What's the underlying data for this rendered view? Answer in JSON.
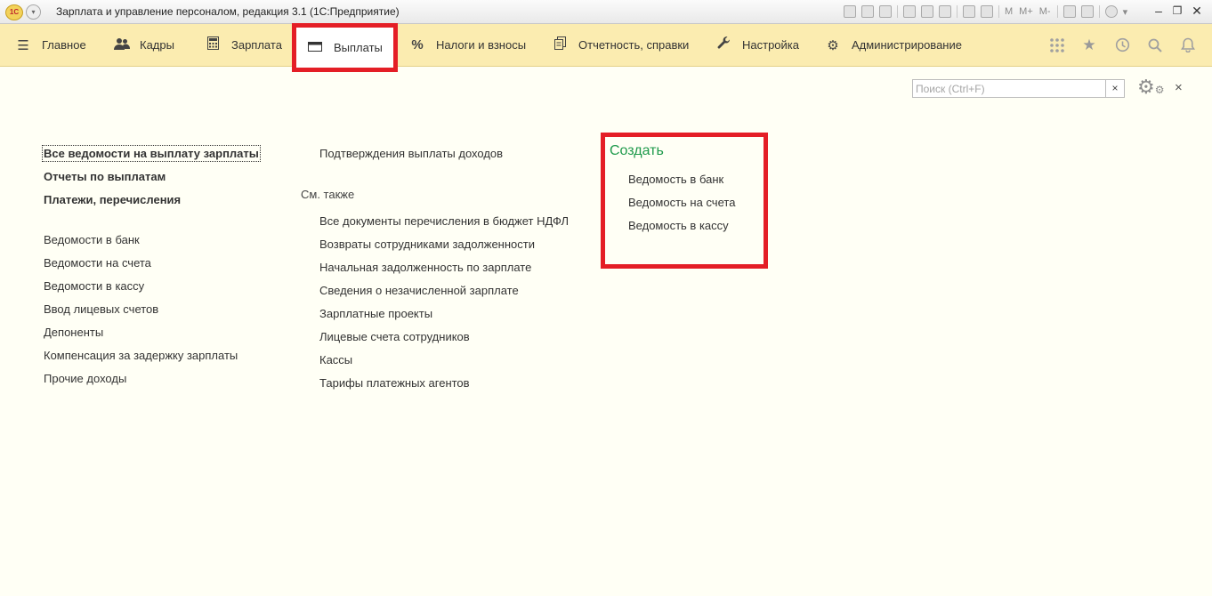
{
  "window": {
    "title": "Зарплата и управление персоналом, редакция 3.1  (1С:Предприятие)",
    "logo_text": "1С",
    "toolbar_letters": [
      "M",
      "M+",
      "M-"
    ]
  },
  "nav": {
    "items": [
      {
        "label": "Главное",
        "icon": "menu-icon"
      },
      {
        "label": "Кадры",
        "icon": "users-icon"
      },
      {
        "label": "Зарплата",
        "icon": "calculator-icon"
      },
      {
        "label": "Выплаты",
        "icon": "wallet-icon",
        "active": true
      },
      {
        "label": "Налоги и взносы",
        "icon": "percent-icon"
      },
      {
        "label": "Отчетность, справки",
        "icon": "documents-icon"
      },
      {
        "label": "Настройка",
        "icon": "wrench-icon"
      },
      {
        "label": "Администрирование",
        "icon": "gear-icon"
      }
    ],
    "percent_glyph": "%"
  },
  "search": {
    "placeholder": "Поиск (Ctrl+F)",
    "value": "",
    "clear_glyph": "×"
  },
  "close_glyph": "×",
  "col1": {
    "bold_links": [
      "Все ведомости на выплату зарплаты",
      "Отчеты по выплатам",
      "Платежи, перечисления"
    ],
    "links": [
      "Ведомости в банк",
      "Ведомости на счета",
      "Ведомости в кассу",
      "Ввод лицевых счетов",
      "Депоненты",
      "Компенсация за задержку зарплаты",
      "Прочие доходы"
    ]
  },
  "col2": {
    "top_link": "Подтверждения выплаты доходов",
    "see_also": "См. также",
    "links": [
      "Все документы перечисления в бюджет НДФЛ",
      "Возвраты сотрудниками задолженности",
      "Начальная задолженность по зарплате",
      "Сведения о незачисленной зарплате",
      "Зарплатные проекты",
      "Лицевые счета сотрудников",
      "Кассы",
      "Тарифы платежных агентов"
    ]
  },
  "create": {
    "title": "Создать",
    "links": [
      "Ведомость в банк",
      "Ведомость на счета",
      "Ведомость в кассу"
    ]
  },
  "colors": {
    "nav_background": "#fbecb0",
    "highlight": "#e41e26",
    "create_title": "#1e9a4b",
    "page_background": "#fffff5"
  }
}
